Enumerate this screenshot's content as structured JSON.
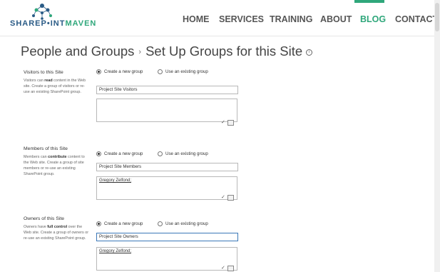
{
  "header": {
    "logo": {
      "part1": "SHAREP",
      "part2": "INT",
      "part3": "MAVEN"
    },
    "nav": [
      {
        "label": "HOME",
        "active": false
      },
      {
        "label": "SERVICES",
        "active": false
      },
      {
        "label": "TRAINING",
        "active": false
      },
      {
        "label": "ABOUT",
        "active": false
      },
      {
        "label": "BLOG",
        "active": true
      },
      {
        "label": "CONTACT",
        "active": false
      }
    ]
  },
  "page": {
    "breadcrumb_parent": "People and Groups",
    "separator": "›",
    "title": "Set Up Groups for this Site",
    "info_glyph": "i"
  },
  "radio_labels": {
    "create": "Create a new group",
    "existing": "Use an existing group"
  },
  "sections": [
    {
      "title": "Visitors to this Site",
      "desc_before": "Visitors can ",
      "desc_bold": "read",
      "desc_after": " content in the Web site. Create a group of visitors or re-use an existing SharePoint group.",
      "selected_option": "create",
      "group_name": "Project Site Visitors",
      "people": ""
    },
    {
      "title": "Members of this Site",
      "desc_before": "Members can ",
      "desc_bold": "contribute",
      "desc_after": " content to the Web site. Create a group of site members or re-use an existing SharePoint group.",
      "selected_option": "create",
      "group_name": "Project Site Members",
      "people": "Gregory Zelfond;"
    },
    {
      "title": "Owners of this Site",
      "desc_before": "Owners have ",
      "desc_bold": "full control",
      "desc_after": " over the Web site. Create a group of owners or re-use an existing SharePoint group.",
      "selected_option": "create",
      "group_name": "Project Site Owners",
      "people": "Gregory Zelfond;"
    }
  ],
  "colors": {
    "accent": "#2fa77b",
    "brand_blue": "#2a5b86",
    "focus_border": "#3b78b8"
  },
  "icons": {
    "check_names": "check-names-icon",
    "browse": "address-book-icon"
  }
}
